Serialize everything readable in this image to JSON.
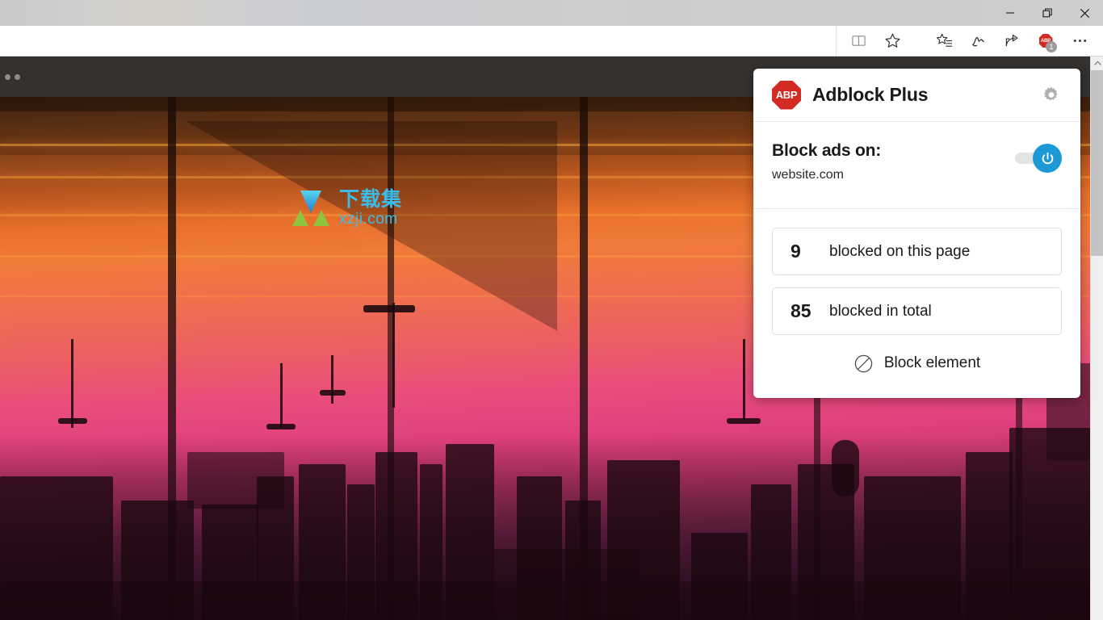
{
  "window": {
    "controls": [
      {
        "name": "minimize",
        "label": "—"
      },
      {
        "name": "restore",
        "label": "❐"
      },
      {
        "name": "close",
        "label": "✕"
      }
    ]
  },
  "toolbar": {
    "address_value": "",
    "address_placeholder": "",
    "buttons": [
      {
        "name": "reading-view-icon",
        "label": "Reading view"
      },
      {
        "name": "favorite-star-icon",
        "label": "Add to favorites or reading list"
      },
      {
        "name": "hub-favorites-icon",
        "label": "Hub (favorites, reading list, history, downloads)"
      },
      {
        "name": "web-note-icon",
        "label": "Make a Web Note"
      },
      {
        "name": "share-icon",
        "label": "Share"
      },
      {
        "name": "abp-extension-icon",
        "label": "Adblock Plus",
        "badge": "1"
      },
      {
        "name": "more-settings-icon",
        "label": "Settings and more"
      }
    ]
  },
  "page": {
    "watermark": {
      "cn": "下载集",
      "en": "xzji.com"
    }
  },
  "popup": {
    "logo_text": "ABP",
    "title": "Adblock Plus",
    "settings_icon": "gear-icon",
    "block_ads_label": "Block ads on:",
    "domain": "website.com",
    "toggle": {
      "state": "on",
      "icon": "power-icon"
    },
    "stats": [
      {
        "count": "9",
        "label": "blocked on this page"
      },
      {
        "count": "85",
        "label": "blocked in total"
      }
    ],
    "block_element": {
      "icon": "prohibition-icon",
      "label": "Block element"
    }
  },
  "colors": {
    "abp_red": "#d32a24",
    "toggle_blue": "#1b9ad6",
    "watermark_blue": "#39c0f0",
    "watermark_green": "#8cc63f",
    "badge_gray": "#9b9b9b"
  },
  "scrollbar": {
    "up_arrow": "scroll-up-icon"
  }
}
